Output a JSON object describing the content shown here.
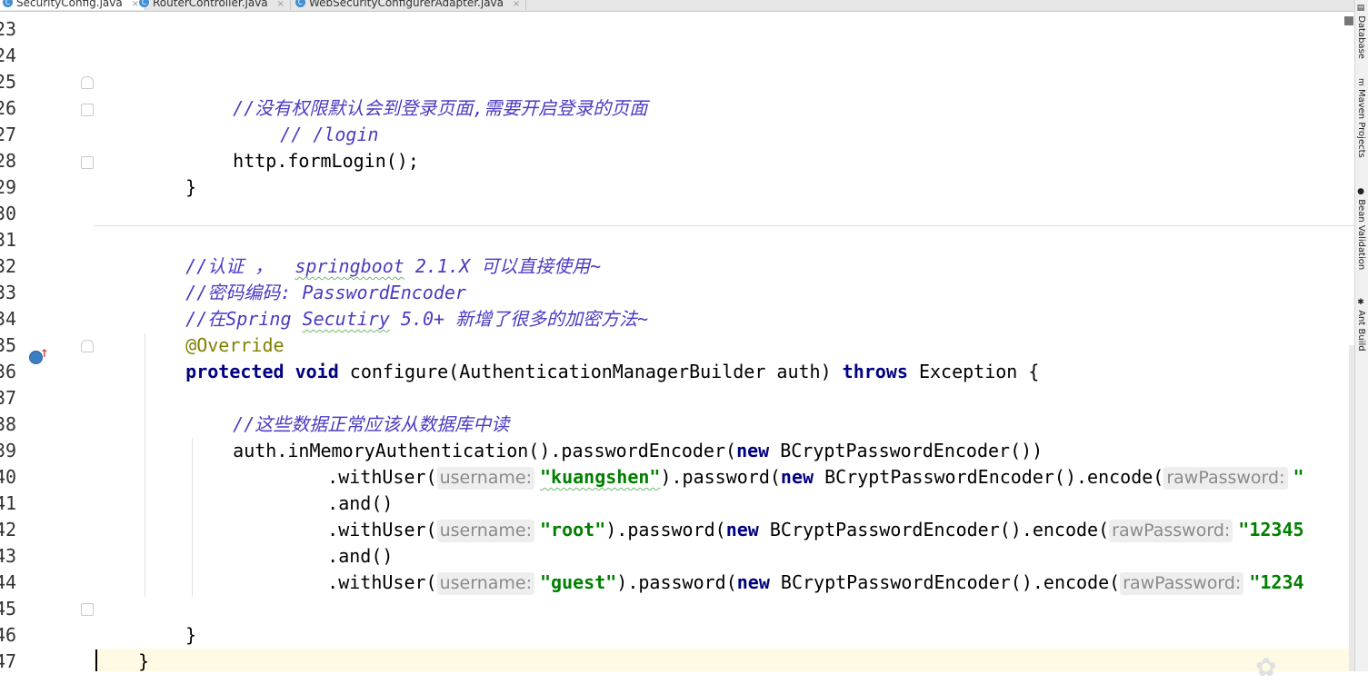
{
  "tabs": [
    {
      "label": "SecurityConfig.java",
      "active": true
    },
    {
      "label": "RouterController.java",
      "active": false
    },
    {
      "label": "WebSecurityConfigurerAdapter.java",
      "active": false
    }
  ],
  "tab_close_glyph": "×",
  "line_numbers": [
    "23",
    "24",
    "25",
    "26",
    "27",
    "28",
    "29",
    "30",
    "31",
    "32",
    "33",
    "34",
    "35",
    "36",
    "37",
    "38",
    "39",
    "40",
    "41",
    "42",
    "43",
    "44",
    "45",
    "46",
    "47"
  ],
  "code": {
    "l25_comment": "//没有权限默认会到登录页面,需要开启登录的页面",
    "l26_comment": "// /login",
    "l27_code": "http.formLogin();",
    "brace_close": "}",
    "l31_comment_a": "//认证 ，  ",
    "l31_comment_b": "springboot",
    "l31_comment_c": " 2.1.X 可以直接使用~",
    "l32_comment": "//密码编码: PasswordEncoder",
    "l33_comment_a": "//在Spring ",
    "l33_comment_b": "Secutiry",
    "l33_comment_c": " 5.0+ 新增了很多的加密方法~",
    "l34_annotation": "@Override",
    "kw_protected": "protected",
    "kw_void": "void",
    "l35_sig": " configure(AuthenticationManagerBuilder auth) ",
    "kw_throws": "throws",
    "l35_tail": " Exception {",
    "l37_comment": "//这些数据正常应该从数据库中读",
    "l38_a": "auth.inMemoryAuthentication().passwordEncoder(",
    "kw_new": "new",
    "l38_b": " BCryptPasswordEncoder())",
    "withUser_open": ".withUser(",
    "hint_username": "username:",
    "str_kuangshen": "\"kuangshen\"",
    "str_root": "\"root\"",
    "str_guest": "\"guest\"",
    "password_open": ").password(",
    "encode_open": " BCryptPasswordEncoder().encode(",
    "hint_raw": "rawPassword:",
    "l39_tail": "\"",
    "l41_tail": "\"12345",
    "l43_tail": "\"1234",
    "and_call": ".and()"
  },
  "right_panel": [
    {
      "label": "Database",
      "icon": "database-icon"
    },
    {
      "label": "Maven Projects",
      "icon": "maven-icon"
    },
    {
      "label": "Bean Validation",
      "icon": "bean-icon"
    },
    {
      "label": "Ant Build",
      "icon": "ant-icon"
    }
  ]
}
